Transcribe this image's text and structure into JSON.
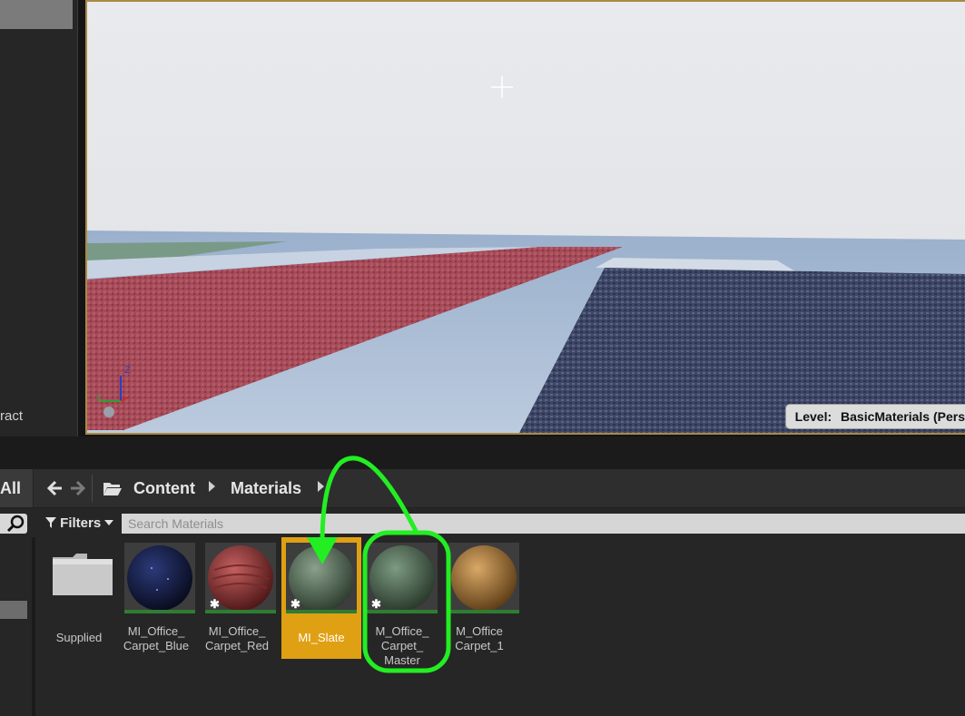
{
  "left_panel": {
    "label": "ract"
  },
  "viewport": {
    "level_label": "Level:",
    "level_name": "BasicMaterials (Pers",
    "axis": {
      "z": "Z",
      "y": "Y"
    }
  },
  "path_bar": {
    "all_tab": "All",
    "back_icon": "arrow-left-icon",
    "forward_icon": "arrow-right-icon",
    "folder_icon": "folder-open-icon",
    "crumbs": [
      "Content",
      "Materials"
    ]
  },
  "filter_bar": {
    "filters_label": "Filters",
    "search_placeholder": "Search Materials"
  },
  "assets": [
    {
      "name": "Supplied",
      "kind": "folder"
    },
    {
      "name": "MI_Office_\nCarpet_Blue",
      "kind": "material-instance"
    },
    {
      "name": "MI_Office_\nCarpet_Red",
      "kind": "material-instance"
    },
    {
      "name": "MI_Slate",
      "kind": "material-instance",
      "selected": true
    },
    {
      "name": "M_Office_\nCarpet_\nMaster",
      "kind": "material"
    },
    {
      "name": "M_Office\nCarpet_1",
      "kind": "material"
    }
  ],
  "colors": {
    "selection": "#e0a013",
    "annotation": "#22ee22",
    "viewport_border": "#a98a44"
  }
}
